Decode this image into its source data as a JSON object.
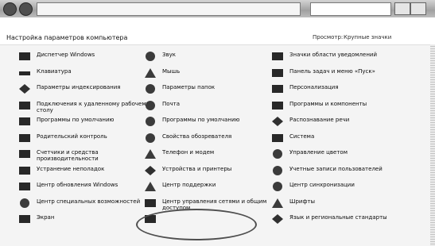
{
  "header": {
    "title": "Настройка параметров компьютера",
    "view_label": "Просмотр:",
    "view_value": "Крупные значки"
  },
  "items": [
    {
      "label": "Диспетчер Windows",
      "icon": "control-icon"
    },
    {
      "label": "Звук",
      "icon": "speaker-icon"
    },
    {
      "label": "Значки области уведомлений",
      "icon": "notify-icon"
    },
    {
      "label": "Клавиатура",
      "icon": "keyboard-icon"
    },
    {
      "label": "Мышь",
      "icon": "mouse-icon"
    },
    {
      "label": "Панель задач и меню «Пуск»",
      "icon": "taskbar-icon"
    },
    {
      "label": "Параметры индексирования",
      "icon": "index-icon"
    },
    {
      "label": "Параметры папок",
      "icon": "folder-icon"
    },
    {
      "label": "Персонализация",
      "icon": "personalize-icon"
    },
    {
      "label": "Подключения к удаленному рабочему столу",
      "icon": "remote-icon"
    },
    {
      "label": "Почта",
      "icon": "mail-icon"
    },
    {
      "label": "Программы и компоненты",
      "icon": "programs-icon"
    },
    {
      "label": "Программы по умолчанию",
      "icon": "defaults-icon"
    },
    {
      "label": "Программы по умолчанию",
      "icon": "defaults2-icon"
    },
    {
      "label": "Распознавание речи",
      "icon": "speech-icon"
    },
    {
      "label": "Родительский контроль",
      "icon": "parental-icon"
    },
    {
      "label": "Свойства обозревателя",
      "icon": "globe-icon"
    },
    {
      "label": "Система",
      "icon": "system-icon"
    },
    {
      "label": "Счетчики и средства производительности",
      "icon": "perf-icon"
    },
    {
      "label": "Телефон и модем",
      "icon": "phone-icon"
    },
    {
      "label": "Управление цветом",
      "icon": "color-icon"
    },
    {
      "label": "Устранение неполадок",
      "icon": "troubleshoot-icon"
    },
    {
      "label": "Устройства и принтеры",
      "icon": "printer-icon"
    },
    {
      "label": "Учетные записи пользователей",
      "icon": "users-icon"
    },
    {
      "label": "Центр обновления Windows",
      "icon": "update-icon"
    },
    {
      "label": "Центр поддержки",
      "icon": "flag-icon"
    },
    {
      "label": "Центр синхронизации",
      "icon": "sync-icon"
    },
    {
      "label": "Центр специальных возможностей",
      "icon": "access-icon"
    },
    {
      "label": "Центр управления сетями и общим доступом",
      "icon": "network-icon"
    },
    {
      "label": "Шрифты",
      "icon": "font-icon"
    },
    {
      "label": "Экран",
      "icon": "screen-icon"
    },
    {
      "label": "",
      "icon": "monitor-icon"
    },
    {
      "label": "Язык и региональные стандарты",
      "icon": "region-icon"
    }
  ],
  "highlight_item": "Центр управления сетями и общим доступом"
}
